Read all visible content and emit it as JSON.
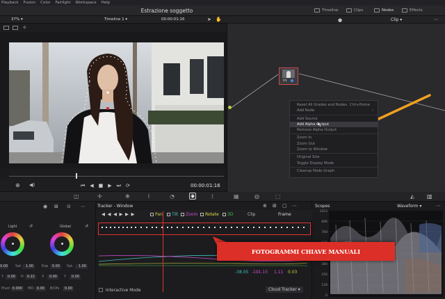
{
  "menu": [
    "Playback",
    "Fusion",
    "Color",
    "Fairlight",
    "Workspace",
    "Help"
  ],
  "app_title": "Estrazione soggetto",
  "top_right": {
    "timeline": "Timeline",
    "clips": "Clips",
    "nodes": "Nodes",
    "effects": "Effects"
  },
  "viewer": {
    "zoom": "37%",
    "timeline_name": "Timeline 1",
    "timecode_top": "00:00:01:16",
    "timecode": "00:00:01:16"
  },
  "node_panel": {
    "mode": "Clip",
    "node_number": "01"
  },
  "context_menu": {
    "items": [
      {
        "label": "Reset All Grades and Nodes",
        "shortcut": "Ctrl+Home"
      },
      {
        "label": "Add Node",
        "submenu": true
      },
      {
        "sep": true
      },
      {
        "label": "Add Source"
      },
      {
        "label": "Add Alpha Output",
        "highlighted": true
      },
      {
        "label": "Remove Alpha Output"
      },
      {
        "sep": true
      },
      {
        "label": "Zoom In"
      },
      {
        "label": "Zoom Out"
      },
      {
        "label": "Zoom to Window"
      },
      {
        "sep": true
      },
      {
        "label": "Original Size"
      },
      {
        "label": "Toggle Display Mode"
      },
      {
        "sep": true
      },
      {
        "label": "Cleanup Node Graph"
      }
    ]
  },
  "color_panel": {
    "wheel1": "Light",
    "wheel2": "Global",
    "row1": {
      "v1": "0.00",
      "sat_label": "Sat",
      "sat": "1.00",
      "exp_label": "Exp",
      "exp": "0.00",
      "sat2_label": "Sat",
      "sat2": "1.00"
    },
    "row2": {
      "y_label": "Y",
      "y": "0.00",
      "h_label": "H",
      "h": "0.22",
      "x_label": "X",
      "x": "0.00",
      "y2_label": "Y",
      "y2": "0.00"
    },
    "pivot_label": "Pivot",
    "pivot": "0.000",
    "md_label": "MD",
    "md": "0.00",
    "bofs_label": "B/Ofs",
    "bofs": "0.00"
  },
  "tracker": {
    "title": "Tracker - Window",
    "options": [
      "Pan",
      "Tilt",
      "Zoom",
      "Rotate",
      "3D"
    ],
    "clip_label": "Clip",
    "frame_label": "Frame",
    "values": [
      "-38.05",
      "-191.15",
      "1.11",
      "0.03"
    ],
    "interactive_mode": "Interactive Mode",
    "cloud_tracker": "Cloud Tracker"
  },
  "scopes": {
    "title": "Scopes",
    "mode": "Waveform",
    "scale": [
      "1023",
      "896",
      "768",
      "640",
      "512",
      "384",
      "256",
      "128",
      "0"
    ]
  },
  "annotation": "FOTOGRAMMI CHIAVE MANUALI",
  "colors": {
    "accent_orange": "#f0a020",
    "annotation_red": "#dc2f27",
    "highlight_blue": "#4a8ad8"
  }
}
